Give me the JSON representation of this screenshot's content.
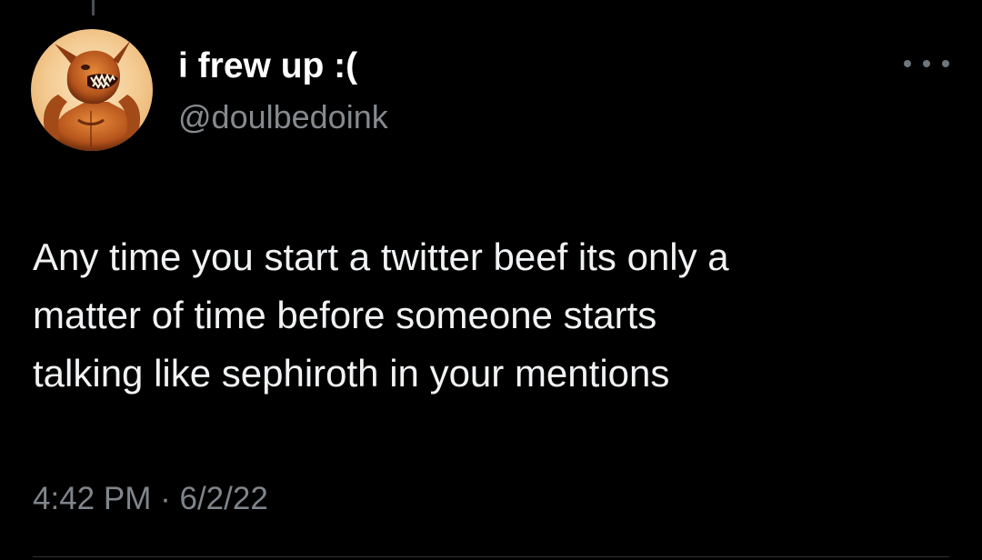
{
  "tweet": {
    "author": {
      "display_name": "i frew up :(",
      "handle": "@doulbedoink",
      "avatar": "orange-demon-creature-avatar"
    },
    "more_icon": "more-horizontal-icon",
    "text_lines": [
      "Any time you start a twitter beef its only a",
      "matter of time before someone starts",
      "talking like sephiroth in your mentions"
    ],
    "time": "4:42 PM",
    "separator": "·",
    "date": "6/2/22"
  },
  "colors": {
    "background": "#000000",
    "display_name": "#ffffff",
    "secondary_text": "#7f858b",
    "body_text": "#f0f2f4",
    "avatar_accent": "#d9782a"
  }
}
